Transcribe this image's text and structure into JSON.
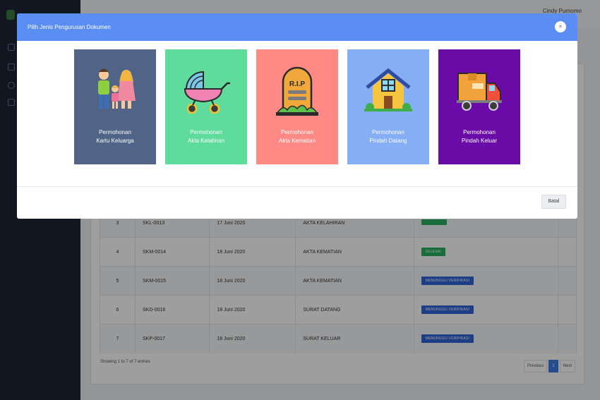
{
  "header": {
    "user_name": "Cindy Purnomo"
  },
  "table": {
    "rows": [
      {
        "no": "3",
        "code": "SKL-0013",
        "date": "17 Juni 2020",
        "type": "AKTA KELAHIRAN",
        "status": "",
        "status_kind": "green"
      },
      {
        "no": "4",
        "code": "SKM-0014",
        "date": "18 Juni 2020",
        "type": "AKTA KEMATIAN",
        "status": "SELESAI",
        "status_kind": "green"
      },
      {
        "no": "5",
        "code": "SKM-0015",
        "date": "18 Juni 2020",
        "type": "AKTA KEMATIAN",
        "status": "MENUNGGU VERIFIKASI",
        "status_kind": "blue"
      },
      {
        "no": "6",
        "code": "SKD-0016",
        "date": "18 Juni 2020",
        "type": "SURAT DATANG",
        "status": "MENUNGGU VERIFIKASI",
        "status_kind": "blue"
      },
      {
        "no": "7",
        "code": "SKP-0017",
        "date": "18 Juni 2020",
        "type": "SURAT KELUAR",
        "status": "MENUNGGU VERIFIKASI",
        "status_kind": "blue"
      }
    ],
    "footer_info": "Showing 1 to 7 of 7 entries"
  },
  "pagination": {
    "previous": "Previous",
    "current": "1",
    "next": "Next"
  },
  "modal": {
    "title": "Pilih Jenis Pengurusan Dokumen",
    "close_glyph": "×",
    "cancel_label": "Batal",
    "cards": [
      {
        "line1": "Permohonan",
        "line2": "Kartu Keluarga",
        "color": "#4f6486",
        "icon": "family-icon"
      },
      {
        "line1": "Permohonan",
        "line2": "Akta Kelahiran",
        "color": "#5fdc9c",
        "icon": "baby-carriage-icon"
      },
      {
        "line1": "Permohonan",
        "line2": "Akta Kematian",
        "color": "#ff8a85",
        "icon": "tombstone-icon"
      },
      {
        "line1": "Permohonan",
        "line2": "Pindah Datang",
        "color": "#86aef4",
        "icon": "house-icon"
      },
      {
        "line1": "Permohonan",
        "line2": "Pindah Keluar",
        "color": "#6a0aa7",
        "icon": "moving-truck-icon"
      }
    ],
    "icons": {
      "tombstone_text": "R.I.P"
    }
  }
}
